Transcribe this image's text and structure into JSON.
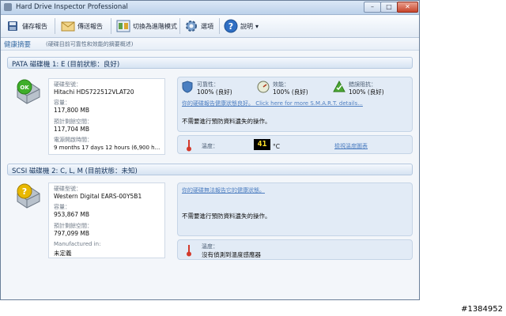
{
  "window": {
    "title": "Hard Drive Inspector Professional",
    "buttons": {
      "minimize": "–",
      "maximize": "□",
      "close": "✕"
    }
  },
  "toolbar": {
    "save_report": "儲存報告",
    "send_report": "傳送報告",
    "advanced_mode": "切換為進階模式",
    "options": "選項",
    "help": "說明",
    "help_arrow": "▾"
  },
  "summary": {
    "title": "健康摘要",
    "subtitle": "(硬碟目前可靠性和效能的摘要概述)"
  },
  "drives": [
    {
      "header": "PATA 磁碟機 1: E (目前狀態：良好)",
      "icon_badge": "OK",
      "badge_color": "#3fae2a",
      "info": {
        "model_label": "硬碟型號：",
        "model_value": "Hitachi HDS722512VLAT20",
        "capacity_label": "容量：",
        "capacity_value": "117,800 MB",
        "free_label": "預計剩餘空間：",
        "free_value": "117,704 MB",
        "uptime_label": "電源開啟時間：",
        "uptime_value": "9 months 17 days 12 hours (6,900 h..."
      },
      "status": {
        "reliability_label": "可靠性：",
        "reliability_value": "100% (良好)",
        "performance_label": "效能：",
        "performance_value": "100% (良好)",
        "error_label": "錯誤阻抗：",
        "error_value": "100% (良好)",
        "smart_link": "你的硬碟報告健康狀態良好。 Click here for more S.M.A.R.T. details...",
        "message": "不需要進行預防資料遺失的操作。",
        "temp_label": "溫度：",
        "temp_value": "41",
        "temp_unit": "°C",
        "temp_link": "檢視溫度圖表"
      }
    },
    {
      "header": "SCSI 磁碟機 2: C, L, M (目前狀態：未知)",
      "icon_badge": "?",
      "badge_color": "#e8b800",
      "info": {
        "model_label": "硬碟型號：",
        "model_value": "Western Digital EARS-00Y5B1",
        "capacity_label": "容量：",
        "capacity_value": "953,867 MB",
        "free_label": "預計剩餘空間：",
        "free_value": "797,099 MB",
        "manufactured_label": "Manufactured in:",
        "manufactured_value": "未定義"
      },
      "status": {
        "health_link": "你的硬碟無法報告它的健康狀態。",
        "message": "不需要進行預防資料遺失的操作。",
        "temp_label": "溫度：",
        "temp_message": "沒有偵測到溫度感應器"
      }
    }
  ],
  "watermark": "#1384952"
}
